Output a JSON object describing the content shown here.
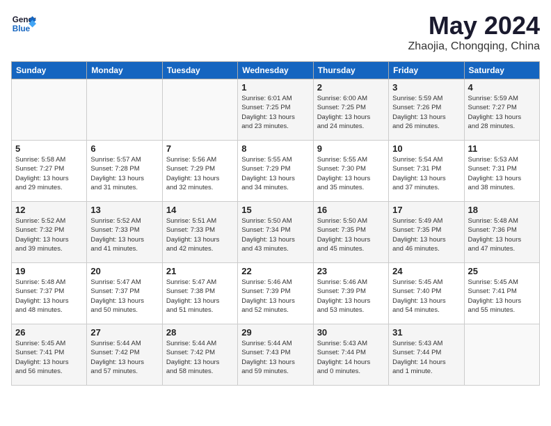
{
  "header": {
    "logo_line1": "General",
    "logo_line2": "Blue",
    "month": "May 2024",
    "location": "Zhaojia, Chongqing, China"
  },
  "weekdays": [
    "Sunday",
    "Monday",
    "Tuesday",
    "Wednesday",
    "Thursday",
    "Friday",
    "Saturday"
  ],
  "weeks": [
    [
      {
        "day": "",
        "info": ""
      },
      {
        "day": "",
        "info": ""
      },
      {
        "day": "",
        "info": ""
      },
      {
        "day": "1",
        "info": "Sunrise: 6:01 AM\nSunset: 7:25 PM\nDaylight: 13 hours\nand 23 minutes."
      },
      {
        "day": "2",
        "info": "Sunrise: 6:00 AM\nSunset: 7:25 PM\nDaylight: 13 hours\nand 24 minutes."
      },
      {
        "day": "3",
        "info": "Sunrise: 5:59 AM\nSunset: 7:26 PM\nDaylight: 13 hours\nand 26 minutes."
      },
      {
        "day": "4",
        "info": "Sunrise: 5:59 AM\nSunset: 7:27 PM\nDaylight: 13 hours\nand 28 minutes."
      }
    ],
    [
      {
        "day": "5",
        "info": "Sunrise: 5:58 AM\nSunset: 7:27 PM\nDaylight: 13 hours\nand 29 minutes."
      },
      {
        "day": "6",
        "info": "Sunrise: 5:57 AM\nSunset: 7:28 PM\nDaylight: 13 hours\nand 31 minutes."
      },
      {
        "day": "7",
        "info": "Sunrise: 5:56 AM\nSunset: 7:29 PM\nDaylight: 13 hours\nand 32 minutes."
      },
      {
        "day": "8",
        "info": "Sunrise: 5:55 AM\nSunset: 7:29 PM\nDaylight: 13 hours\nand 34 minutes."
      },
      {
        "day": "9",
        "info": "Sunrise: 5:55 AM\nSunset: 7:30 PM\nDaylight: 13 hours\nand 35 minutes."
      },
      {
        "day": "10",
        "info": "Sunrise: 5:54 AM\nSunset: 7:31 PM\nDaylight: 13 hours\nand 37 minutes."
      },
      {
        "day": "11",
        "info": "Sunrise: 5:53 AM\nSunset: 7:31 PM\nDaylight: 13 hours\nand 38 minutes."
      }
    ],
    [
      {
        "day": "12",
        "info": "Sunrise: 5:52 AM\nSunset: 7:32 PM\nDaylight: 13 hours\nand 39 minutes."
      },
      {
        "day": "13",
        "info": "Sunrise: 5:52 AM\nSunset: 7:33 PM\nDaylight: 13 hours\nand 41 minutes."
      },
      {
        "day": "14",
        "info": "Sunrise: 5:51 AM\nSunset: 7:33 PM\nDaylight: 13 hours\nand 42 minutes."
      },
      {
        "day": "15",
        "info": "Sunrise: 5:50 AM\nSunset: 7:34 PM\nDaylight: 13 hours\nand 43 minutes."
      },
      {
        "day": "16",
        "info": "Sunrise: 5:50 AM\nSunset: 7:35 PM\nDaylight: 13 hours\nand 45 minutes."
      },
      {
        "day": "17",
        "info": "Sunrise: 5:49 AM\nSunset: 7:35 PM\nDaylight: 13 hours\nand 46 minutes."
      },
      {
        "day": "18",
        "info": "Sunrise: 5:48 AM\nSunset: 7:36 PM\nDaylight: 13 hours\nand 47 minutes."
      }
    ],
    [
      {
        "day": "19",
        "info": "Sunrise: 5:48 AM\nSunset: 7:37 PM\nDaylight: 13 hours\nand 48 minutes."
      },
      {
        "day": "20",
        "info": "Sunrise: 5:47 AM\nSunset: 7:37 PM\nDaylight: 13 hours\nand 50 minutes."
      },
      {
        "day": "21",
        "info": "Sunrise: 5:47 AM\nSunset: 7:38 PM\nDaylight: 13 hours\nand 51 minutes."
      },
      {
        "day": "22",
        "info": "Sunrise: 5:46 AM\nSunset: 7:39 PM\nDaylight: 13 hours\nand 52 minutes."
      },
      {
        "day": "23",
        "info": "Sunrise: 5:46 AM\nSunset: 7:39 PM\nDaylight: 13 hours\nand 53 minutes."
      },
      {
        "day": "24",
        "info": "Sunrise: 5:45 AM\nSunset: 7:40 PM\nDaylight: 13 hours\nand 54 minutes."
      },
      {
        "day": "25",
        "info": "Sunrise: 5:45 AM\nSunset: 7:41 PM\nDaylight: 13 hours\nand 55 minutes."
      }
    ],
    [
      {
        "day": "26",
        "info": "Sunrise: 5:45 AM\nSunset: 7:41 PM\nDaylight: 13 hours\nand 56 minutes."
      },
      {
        "day": "27",
        "info": "Sunrise: 5:44 AM\nSunset: 7:42 PM\nDaylight: 13 hours\nand 57 minutes."
      },
      {
        "day": "28",
        "info": "Sunrise: 5:44 AM\nSunset: 7:42 PM\nDaylight: 13 hours\nand 58 minutes."
      },
      {
        "day": "29",
        "info": "Sunrise: 5:44 AM\nSunset: 7:43 PM\nDaylight: 13 hours\nand 59 minutes."
      },
      {
        "day": "30",
        "info": "Sunrise: 5:43 AM\nSunset: 7:44 PM\nDaylight: 14 hours\nand 0 minutes."
      },
      {
        "day": "31",
        "info": "Sunrise: 5:43 AM\nSunset: 7:44 PM\nDaylight: 14 hours\nand 1 minute."
      },
      {
        "day": "",
        "info": ""
      }
    ]
  ]
}
